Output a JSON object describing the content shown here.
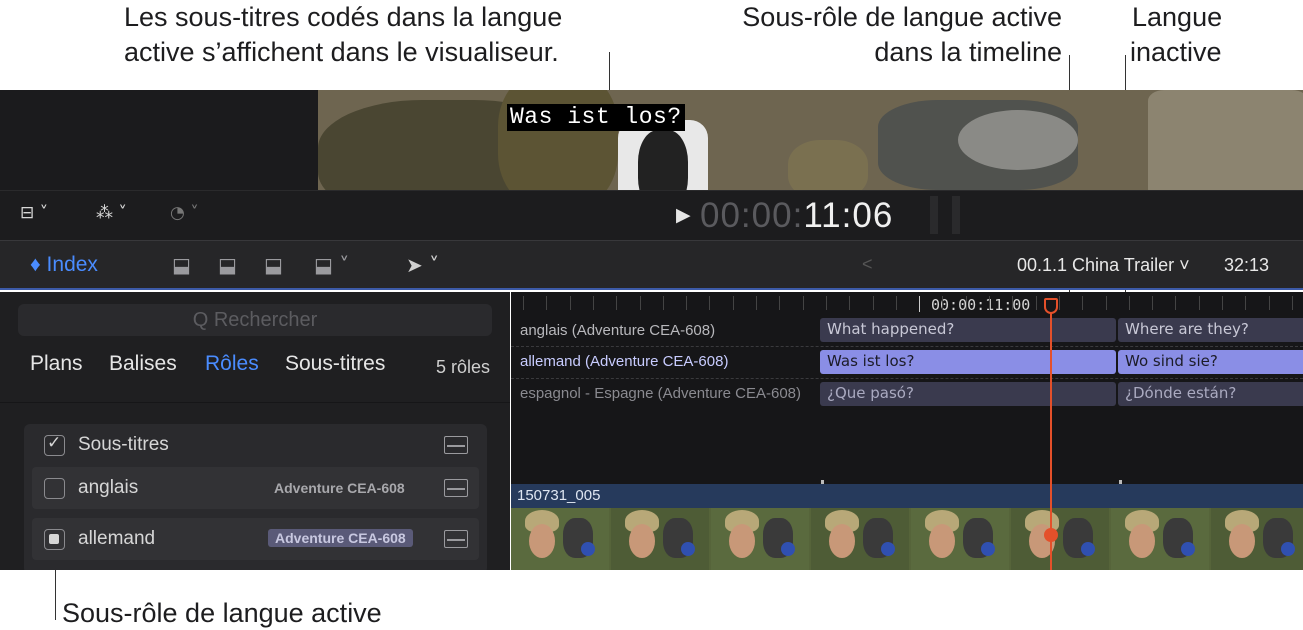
{
  "callouts": {
    "viewer_line1": "Les sous-titres codés dans la langue",
    "viewer_line2": "active s’affichent dans le visualiseur.",
    "active_tl_line1": "Sous-rôle de langue active",
    "active_tl_line2": "dans la timeline",
    "inactive_line1": "Langue",
    "inactive_line2": "inactive",
    "bottom": "Sous-rôle de langue active"
  },
  "viewer": {
    "caption": "Was ist los?"
  },
  "toolbar1": {
    "layout_icon": "clip-appearance-icon",
    "effects_icon": "magic-wand-icon",
    "speed_icon": "speedometer-icon",
    "play_icon": "play-icon",
    "timecode_dim": "00:00:",
    "timecode_bright": "11:06"
  },
  "toolbar2": {
    "index_label": "♦ Index",
    "back_icon": "chevron-left-icon",
    "project_name": "00.1.1 China Trailer ˅",
    "duration": "32:13"
  },
  "index": {
    "search_placeholder": "Q Rechercher",
    "tabs": [
      "Plans",
      "Balises",
      "Rôles",
      "Sous-titres"
    ],
    "active_tab": "Rôles",
    "role_count": "5 rôles",
    "roles": [
      {
        "label": "Sous-titres",
        "tag": "",
        "checked": true
      },
      {
        "label": "anglais",
        "tag": "Adventure CEA-608",
        "checked": false
      },
      {
        "label": "allemand",
        "tag": "Adventure CEA-608",
        "checked": true
      }
    ]
  },
  "timeline": {
    "ruler_timecode": "00:00:11:00",
    "lanes": [
      {
        "name": "anglais (Adventure CEA-608)",
        "captions": [
          "What happened?",
          "Where are they?"
        ]
      },
      {
        "name": "allemand (Adventure CEA-608)",
        "captions": [
          "Was ist los?",
          "Wo sind sie?"
        ]
      },
      {
        "name": "espagnol - Espagne (Adventure CEA-608)",
        "captions": [
          "¿Que pasó?",
          "¿Dónde están?"
        ]
      }
    ],
    "clip_name": "150731_005"
  },
  "colors": {
    "accent_blue": "#4a8cff",
    "active_caption": "#8a8ee6",
    "inactive_caption": "#3a3a4e",
    "playhead": "#e4502a",
    "clip_header": "#263a5c"
  }
}
